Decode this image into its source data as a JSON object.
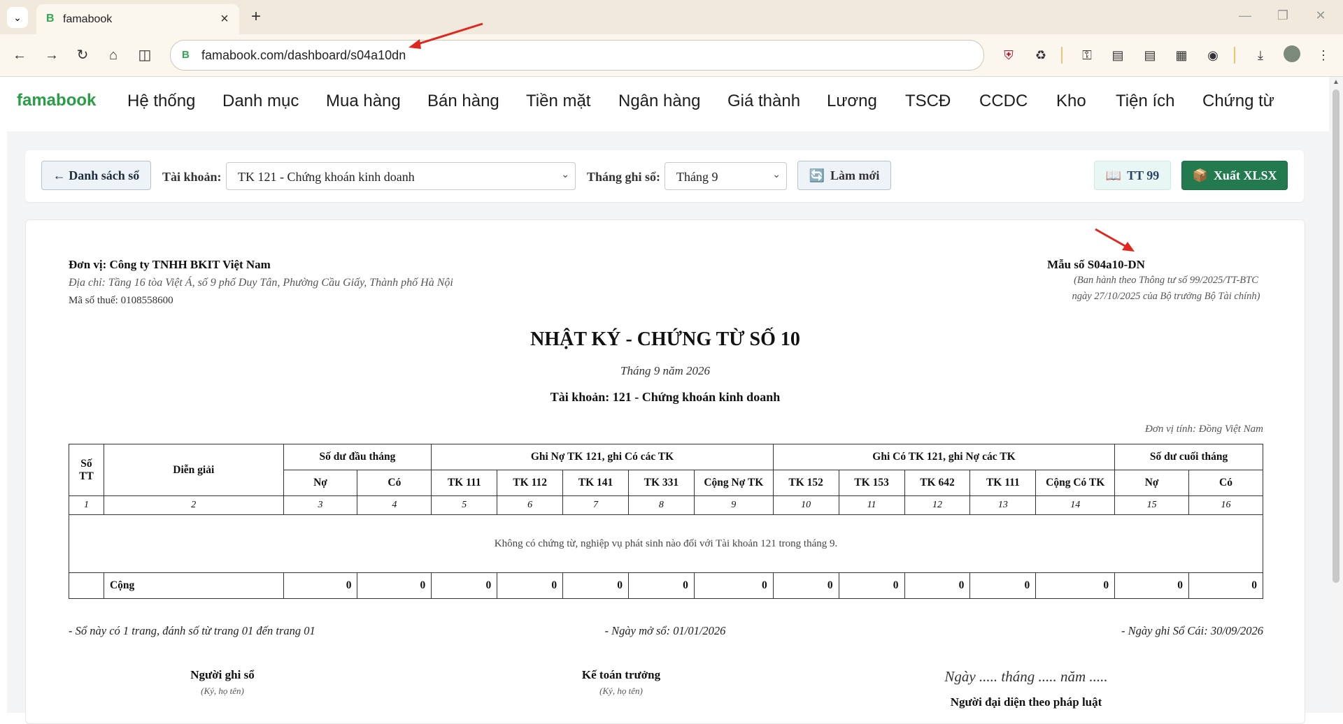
{
  "browser": {
    "tab_title": "famabook",
    "url": "famabook.com/dashboard/s04a10dn"
  },
  "app": {
    "brand": "famabook",
    "nav": [
      "Hệ thống",
      "Danh mục",
      "Mua hàng",
      "Bán hàng",
      "Tiền mặt",
      "Ngân hàng",
      "Giá thành",
      "Lương",
      "TSCĐ",
      "CCDC",
      "Kho",
      "Tiện ích",
      "Chứng từ"
    ]
  },
  "filters": {
    "back_label": "← Danh sách sổ",
    "account_label": "Tài khoản:",
    "account_value": "TK 121 - Chứng khoán kinh doanh",
    "month_label": "Tháng ghi sổ:",
    "month_value": "Tháng 9",
    "refresh_label": "Làm mới",
    "tt_label": "TT 99",
    "export_label": "Xuất XLSX"
  },
  "document": {
    "unit": "Đơn vị: Công ty TNHH BKIT Việt Nam",
    "address": "Địa chỉ: Tầng 16 tòa Việt Á, số 9 phố Duy Tân, Phường Cầu Giấy, Thành phố Hà Nội",
    "tax": "Mã số thuế: 0108558600",
    "form_no": "Mẫu số S04a10-DN",
    "form_note1": "(Ban hành theo Thông tư số 99/2025/TT-BTC",
    "form_note2": "ngày 27/10/2025 của Bộ trưởng Bộ Tài chính)",
    "title": "NHẬT KÝ - CHỨNG TỪ SỐ 10",
    "period": "Tháng 9 năm 2026",
    "account": "Tài khoản: 121 - Chứng khoán kinh doanh",
    "currency": "Đơn vị tính: Đồng Việt Nam",
    "table": {
      "h_stt": "Số TT",
      "h_desc": "Diễn giải",
      "h_open": "Số dư đầu tháng",
      "h_debit": "Ghi Nợ TK 121, ghi Có các TK",
      "h_credit": "Ghi Có TK 121, ghi Nợ các TK",
      "h_close": "Số dư cuối tháng",
      "sub": [
        "Nợ",
        "Có",
        "TK 111",
        "TK 112",
        "TK 141",
        "TK 331",
        "Cộng Nợ TK",
        "TK 152",
        "TK 153",
        "TK 642",
        "TK 111",
        "Cộng Có TK",
        "Nợ",
        "Có"
      ],
      "nums": [
        "1",
        "2",
        "3",
        "4",
        "5",
        "6",
        "7",
        "8",
        "9",
        "10",
        "11",
        "12",
        "13",
        "14",
        "15",
        "16"
      ],
      "empty_msg": "Không có chứng từ, nghiệp vụ phát sinh nào đối với Tài khoản 121 trong tháng 9.",
      "total_label": "Cộng",
      "totals": [
        "0",
        "0",
        "0",
        "0",
        "0",
        "0",
        "0",
        "0",
        "0",
        "0",
        "0",
        "0",
        "0",
        "0"
      ]
    },
    "footer_pages": "- Sổ này có 1 trang, đánh số từ trang 01 đến trang 01",
    "footer_open": "- Ngày mở sổ: 01/01/2026",
    "footer_ledger": "- Ngày ghi Sổ Cái: 30/09/2026",
    "sign_writer": "Người ghi sổ",
    "sign_writer_note": "(Ký, họ tên)",
    "sign_chief": "Kế toán trưởng",
    "sign_chief_note": "(Ký, họ tên)",
    "sign_date": "Ngày ..... tháng ..... năm .....",
    "sign_legal": "Người đại diện theo pháp luật"
  }
}
